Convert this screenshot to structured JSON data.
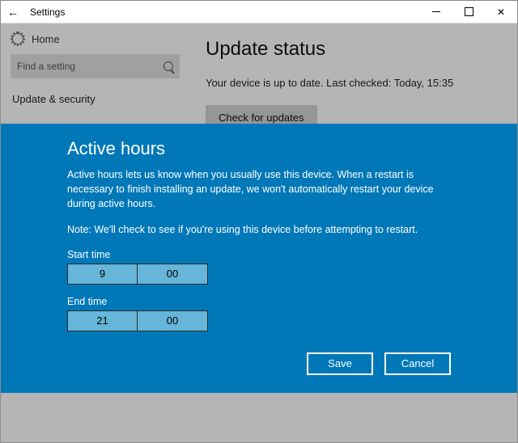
{
  "titlebar": {
    "title": "Settings"
  },
  "sidebar": {
    "home": "Home",
    "search_placeholder": "Find a setting",
    "nav": {
      "update_security": "Update & security"
    }
  },
  "main": {
    "heading": "Update status",
    "status": "Your device is up to date. Last checked: Today, 15:35",
    "check_button": "Check for updates"
  },
  "modal": {
    "title": "Active hours",
    "description": "Active hours lets us know when you usually use this device. When a restart is necessary to finish installing an update, we won't automatically restart your device during active hours.",
    "note": "Note: We'll check to see if you're using this device before attempting to restart.",
    "start_label": "Start time",
    "start_hour": "9",
    "start_min": "00",
    "end_label": "End time",
    "end_hour": "21",
    "end_min": "00",
    "save": "Save",
    "cancel": "Cancel"
  }
}
